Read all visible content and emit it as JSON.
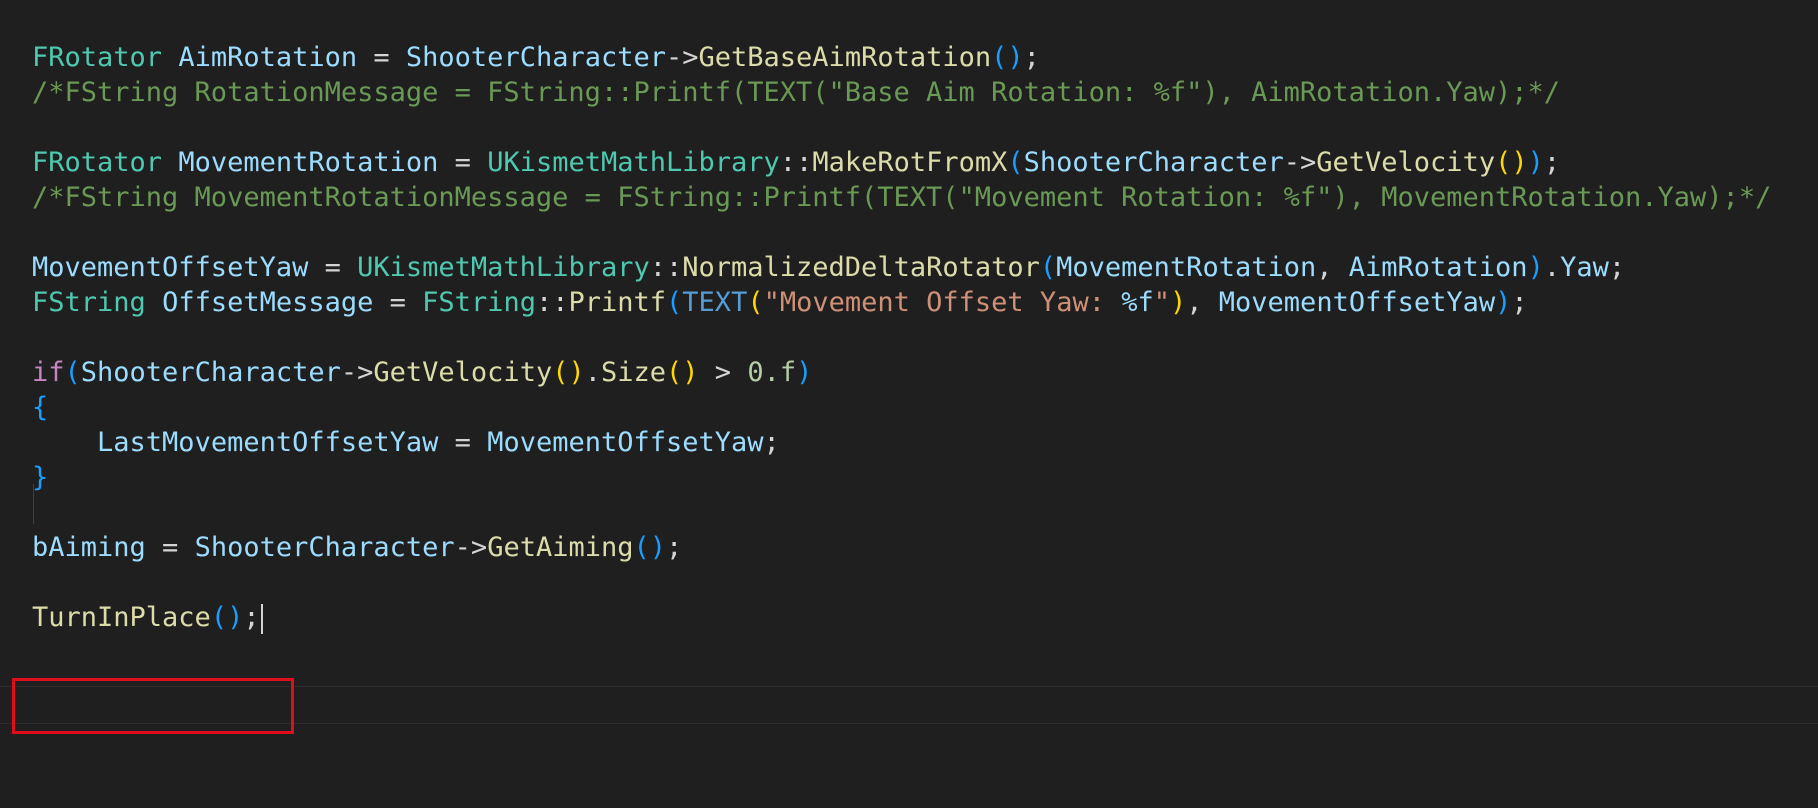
{
  "colors": {
    "background": "#1f1f1f",
    "type": "#4ec9b0",
    "variable": "#9cdcfe",
    "function": "#dcdcaa",
    "operator": "#d4d4d4",
    "comment": "#6a9955",
    "keyword": "#c586c0",
    "macro": "#569cd6",
    "string": "#ce9178",
    "number": "#b5cea8",
    "bracket_level1": "#ffd700",
    "bracket_level2": "#179fff",
    "highlight_box": "#e00d1a"
  },
  "code": {
    "lines": [
      {
        "tokens": [
          {
            "t": "FRotator",
            "c": "type"
          },
          {
            "t": " ",
            "c": "op"
          },
          {
            "t": "AimRotation",
            "c": "var"
          },
          {
            "t": " = ",
            "c": "op"
          },
          {
            "t": "ShooterCharacter",
            "c": "var"
          },
          {
            "t": "->",
            "c": "op"
          },
          {
            "t": "GetBaseAimRotation",
            "c": "func"
          },
          {
            "t": "()",
            "c": "p2"
          },
          {
            "t": ";",
            "c": "op"
          }
        ]
      },
      {
        "tokens": [
          {
            "t": "/*FString RotationMessage = FString::Printf(TEXT(\"Base Aim Rotation: %f\"), AimRotation.Yaw);*/",
            "c": "cmt"
          }
        ]
      },
      {
        "tokens": []
      },
      {
        "tokens": [
          {
            "t": "FRotator",
            "c": "type"
          },
          {
            "t": " ",
            "c": "op"
          },
          {
            "t": "MovementRotation",
            "c": "var"
          },
          {
            "t": " = ",
            "c": "op"
          },
          {
            "t": "UKismetMathLibrary",
            "c": "type"
          },
          {
            "t": "::",
            "c": "op"
          },
          {
            "t": "MakeRotFromX",
            "c": "func"
          },
          {
            "t": "(",
            "c": "p2"
          },
          {
            "t": "ShooterCharacter",
            "c": "var"
          },
          {
            "t": "->",
            "c": "op"
          },
          {
            "t": "GetVelocity",
            "c": "func"
          },
          {
            "t": "()",
            "c": "p1"
          },
          {
            "t": ")",
            "c": "p2"
          },
          {
            "t": ";",
            "c": "op"
          }
        ]
      },
      {
        "tokens": [
          {
            "t": "/*FString MovementRotationMessage = FString::Printf(TEXT(\"Movement Rotation: %f\"), MovementRotation.Yaw);*/",
            "c": "cmt"
          }
        ]
      },
      {
        "tokens": []
      },
      {
        "tokens": [
          {
            "t": "MovementOffsetYaw",
            "c": "var"
          },
          {
            "t": " = ",
            "c": "op"
          },
          {
            "t": "UKismetMathLibrary",
            "c": "type"
          },
          {
            "t": "::",
            "c": "op"
          },
          {
            "t": "NormalizedDeltaRotator",
            "c": "func"
          },
          {
            "t": "(",
            "c": "p2"
          },
          {
            "t": "MovementRotation",
            "c": "var"
          },
          {
            "t": ", ",
            "c": "op"
          },
          {
            "t": "AimRotation",
            "c": "var"
          },
          {
            "t": ")",
            "c": "p2"
          },
          {
            "t": ".",
            "c": "op"
          },
          {
            "t": "Yaw",
            "c": "var"
          },
          {
            "t": ";",
            "c": "op"
          }
        ]
      },
      {
        "tokens": [
          {
            "t": "FString",
            "c": "type"
          },
          {
            "t": " ",
            "c": "op"
          },
          {
            "t": "OffsetMessage",
            "c": "var"
          },
          {
            "t": " = ",
            "c": "op"
          },
          {
            "t": "FString",
            "c": "type"
          },
          {
            "t": "::",
            "c": "op"
          },
          {
            "t": "Printf",
            "c": "func"
          },
          {
            "t": "(",
            "c": "p2"
          },
          {
            "t": "TEXT",
            "c": "macro"
          },
          {
            "t": "(",
            "c": "p1"
          },
          {
            "t": "\"Movement Offset Yaw: ",
            "c": "str"
          },
          {
            "t": "%f",
            "c": "var"
          },
          {
            "t": "\"",
            "c": "str"
          },
          {
            "t": ")",
            "c": "p1"
          },
          {
            "t": ", ",
            "c": "op"
          },
          {
            "t": "MovementOffsetYaw",
            "c": "var"
          },
          {
            "t": ")",
            "c": "p2"
          },
          {
            "t": ";",
            "c": "op"
          }
        ]
      },
      {
        "tokens": []
      },
      {
        "tokens": [
          {
            "t": "if",
            "c": "kw"
          },
          {
            "t": "(",
            "c": "p2"
          },
          {
            "t": "ShooterCharacter",
            "c": "var"
          },
          {
            "t": "->",
            "c": "op"
          },
          {
            "t": "GetVelocity",
            "c": "func"
          },
          {
            "t": "()",
            "c": "p1"
          },
          {
            "t": ".",
            "c": "op"
          },
          {
            "t": "Size",
            "c": "func"
          },
          {
            "t": "()",
            "c": "p1"
          },
          {
            "t": " > ",
            "c": "op"
          },
          {
            "t": "0.f",
            "c": "num"
          },
          {
            "t": ")",
            "c": "p2"
          }
        ]
      },
      {
        "tokens": [
          {
            "t": "{",
            "c": "p2"
          }
        ]
      },
      {
        "tokens": [
          {
            "t": "    ",
            "c": "op"
          },
          {
            "t": "LastMovementOffsetYaw",
            "c": "var"
          },
          {
            "t": " = ",
            "c": "op"
          },
          {
            "t": "MovementOffsetYaw",
            "c": "var"
          },
          {
            "t": ";",
            "c": "op"
          }
        ]
      },
      {
        "tokens": [
          {
            "t": "}",
            "c": "p2"
          }
        ]
      },
      {
        "tokens": []
      },
      {
        "tokens": [
          {
            "t": "bAiming",
            "c": "var"
          },
          {
            "t": " = ",
            "c": "op"
          },
          {
            "t": "ShooterCharacter",
            "c": "var"
          },
          {
            "t": "->",
            "c": "op"
          },
          {
            "t": "GetAiming",
            "c": "func"
          },
          {
            "t": "()",
            "c": "p2"
          },
          {
            "t": ";",
            "c": "op"
          }
        ]
      },
      {
        "tokens": []
      },
      {
        "tokens": [
          {
            "t": "TurnInPlace",
            "c": "func"
          },
          {
            "t": "()",
            "c": "p2"
          },
          {
            "t": ";",
            "c": "op"
          }
        ],
        "cursor": true
      }
    ]
  }
}
